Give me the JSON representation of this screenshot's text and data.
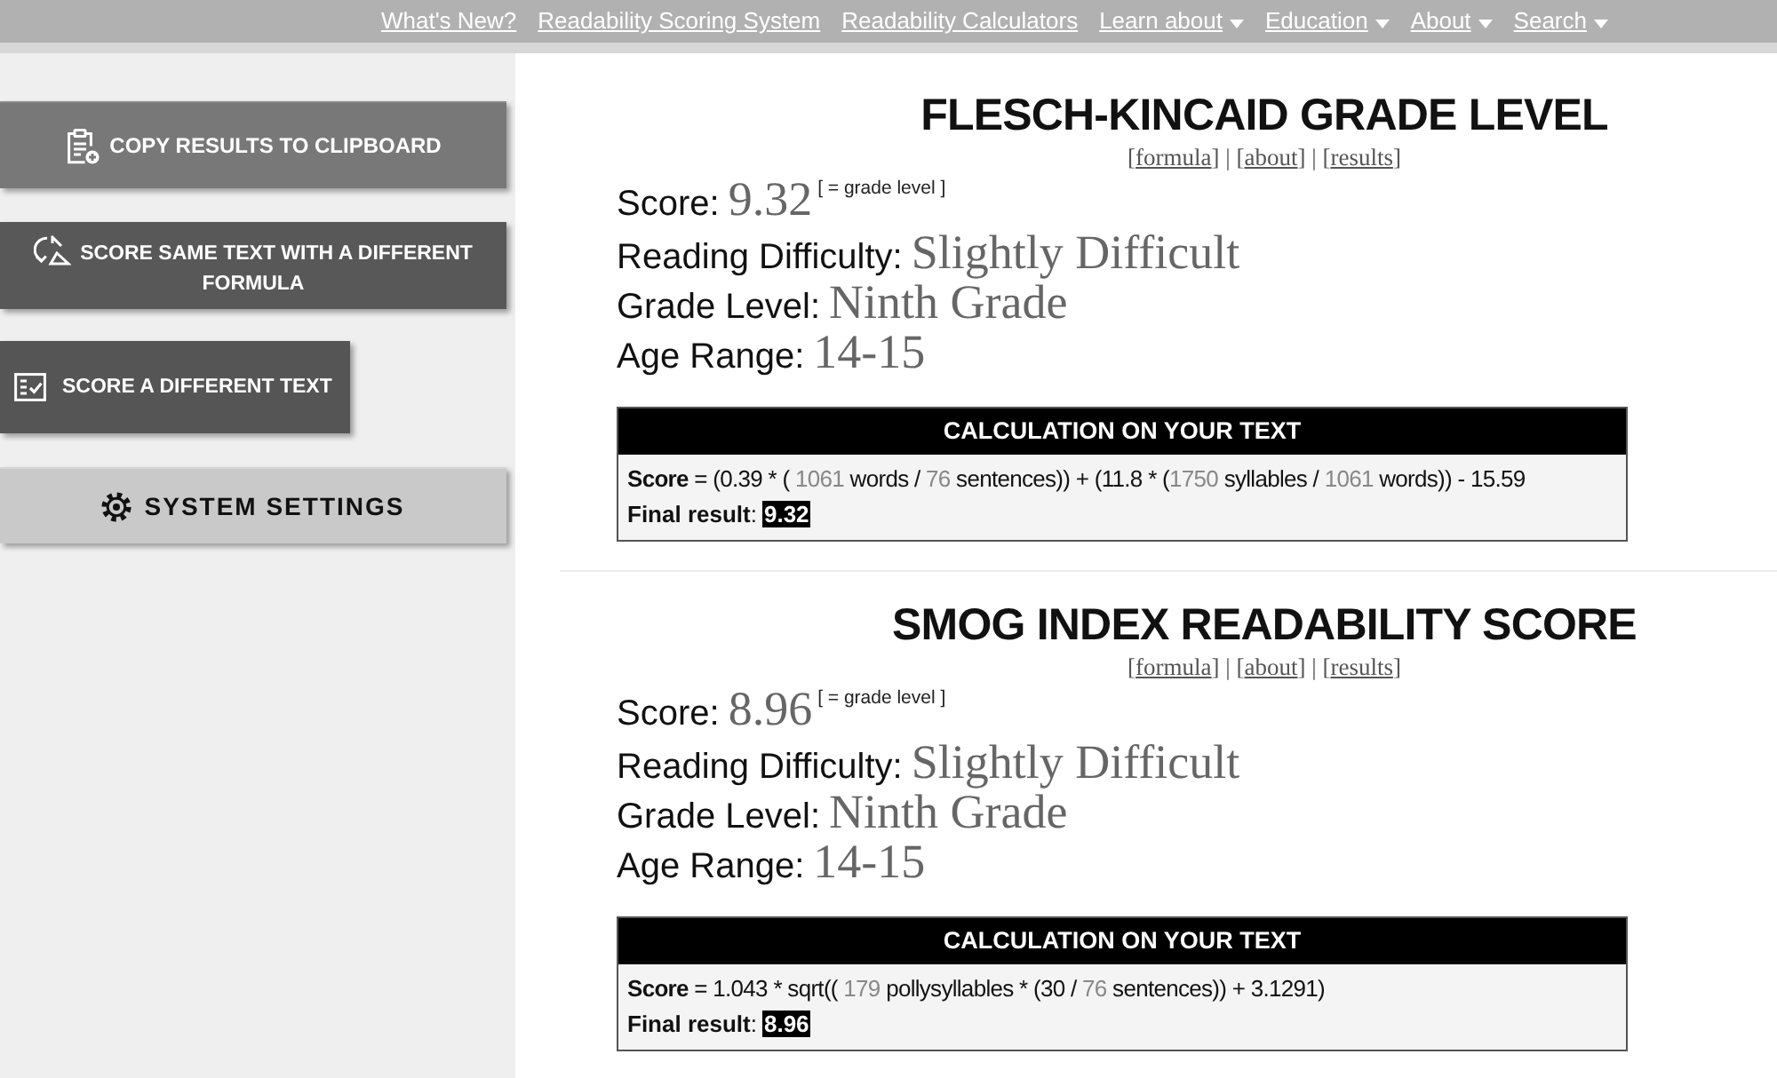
{
  "nav": {
    "links": [
      {
        "label": "What's New?",
        "dropdown": false
      },
      {
        "label": "Readability Scoring System",
        "dropdown": false
      },
      {
        "label": "Readability Calculators",
        "dropdown": false
      },
      {
        "label": "Learn about",
        "dropdown": true
      },
      {
        "label": "Education",
        "dropdown": true
      },
      {
        "label": "About",
        "dropdown": true
      },
      {
        "label": "Search",
        "dropdown": true
      }
    ]
  },
  "sidebar": {
    "buttons": [
      {
        "kind": "copy",
        "label": "COPY RESULTS TO CLIPBOARD"
      },
      {
        "kind": "rescore",
        "label": "SCORE SAME TEXT WITH A DIFFERENT FORMULA"
      },
      {
        "kind": "new",
        "label": "SCORE A DIFFERENT TEXT"
      },
      {
        "kind": "settings",
        "label": "SYSTEM SETTINGS"
      }
    ]
  },
  "sections": [
    {
      "title": "FLESCH-KINCAID GRADE LEVEL",
      "links": {
        "open": "[",
        "close": "]",
        "separator": "|",
        "items": [
          "formula",
          "about",
          "results"
        ]
      },
      "results": [
        {
          "label": "Score:",
          "value": "9.32",
          "note": "[ = grade level ]"
        },
        {
          "label": "Reading Difficulty:",
          "value": "Slightly Difficult"
        },
        {
          "label": "Grade Level:",
          "value": "Ninth Grade"
        },
        {
          "label": "Age Range:",
          "value": "14-15"
        }
      ],
      "calculation": {
        "title": "CALCULATION ON YOUR TEXT",
        "formula": [
          {
            "kind": "term",
            "text": "Score"
          },
          {
            "kind": "text",
            "text": " = (0.39 * ( "
          },
          {
            "kind": "value",
            "text": "1061"
          },
          {
            "kind": "text",
            "text": " words / "
          },
          {
            "kind": "value",
            "text": "76"
          },
          {
            "kind": "text",
            "text": " sentences)) + (11.8 * ("
          },
          {
            "kind": "value",
            "text": "1750"
          },
          {
            "kind": "text",
            "text": " syllables / "
          },
          {
            "kind": "value",
            "text": "1061"
          },
          {
            "kind": "text",
            "text": " words)) - 15.59"
          }
        ],
        "result_label": "**Final result**:",
        "result": "9.32"
      }
    },
    {
      "title": "SMOG INDEX READABILITY SCORE",
      "links": {
        "open": "[",
        "close": "]",
        "separator": "|",
        "items": [
          "formula",
          "about",
          "results"
        ]
      },
      "results": [
        {
          "label": "Score:",
          "value": "8.96",
          "note": "[ = grade level ]"
        },
        {
          "label": "Reading Difficulty:",
          "value": "Slightly Difficult"
        },
        {
          "label": "Grade Level:",
          "value": "Ninth Grade"
        },
        {
          "label": "Age Range:",
          "value": "14-15"
        }
      ],
      "calculation": {
        "title": "CALCULATION ON YOUR TEXT",
        "formula": [
          {
            "kind": "term",
            "text": "Score"
          },
          {
            "kind": "text",
            "text": " = 1.043 * sqrt(( "
          },
          {
            "kind": "value",
            "text": "179"
          },
          {
            "kind": "text",
            "text": " pollysyllables * (30 / "
          },
          {
            "kind": "value",
            "text": "76"
          },
          {
            "kind": "text",
            "text": " sentences)) + 3.1291)"
          }
        ],
        "result_label": "**Final result**:",
        "result": "8.96"
      }
    }
  ]
}
